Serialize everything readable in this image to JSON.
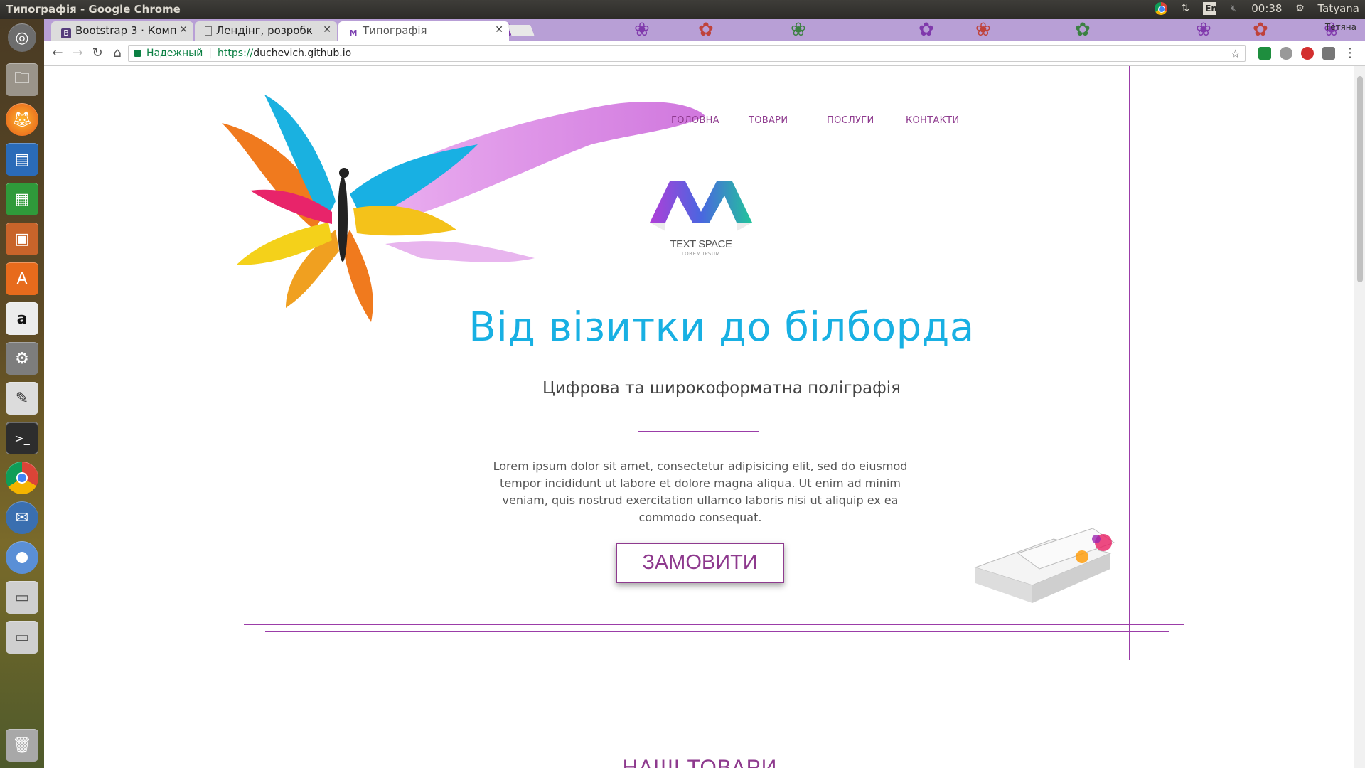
{
  "system": {
    "window_title": "Типографія - Google Chrome",
    "time": "00:38",
    "user": "Tatyana",
    "keyboard_layout": "En"
  },
  "browser": {
    "tabs": [
      {
        "label": "Bootstrap 3 · Комп",
        "favicon": "B"
      },
      {
        "label": "Лендінг, розробк",
        "favicon": "doc"
      },
      {
        "label": "Типографія",
        "favicon": "logo"
      }
    ],
    "profile_name": "Тетяна",
    "secure_label": "Надежный",
    "url": "https://duchevich.github.io",
    "url_proto": "https://",
    "url_host": "duchevich.github.io"
  },
  "launcher": {
    "items": [
      "dash-icon",
      "files-icon",
      "firefox-icon",
      "writer-icon",
      "calc-icon",
      "impress-icon",
      "software-center-icon",
      "amazon-icon",
      "settings-icon",
      "text-editor-icon",
      "terminal-icon",
      "chrome-icon",
      "thunderbird-icon",
      "chromium-icon",
      "drive-icon",
      "drive-icon-2",
      "trash-icon"
    ]
  },
  "page": {
    "nav": [
      "ГОЛОВНА",
      "ТОВАРИ",
      "ПОСЛУГИ",
      "КОНТАКТИ"
    ],
    "logo_text": "TEXT SPACE",
    "logo_sub": "LOREM IPSUM",
    "hero_title": "Від візитки до білборда",
    "hero_subtitle": "Цифрова та широкоформатна поліграфія",
    "lorem": "Lorem ipsum dolor sit amet, consectetur adipisicing elit, sed do eiusmod tempor incididunt ut labore et dolore magna aliqua. Ut enim ad minim veniam, quis nostrud exercitation ullamco laboris nisi ut aliquip ex ea commodo consequat.",
    "order_button": "ЗАМОВИТИ",
    "section_title": "НАШІ ТОВАРИ"
  },
  "colors": {
    "accent": "#8e3a8e",
    "hero_blue": "#18b0e3",
    "tabstrip": "#b89fd6"
  }
}
